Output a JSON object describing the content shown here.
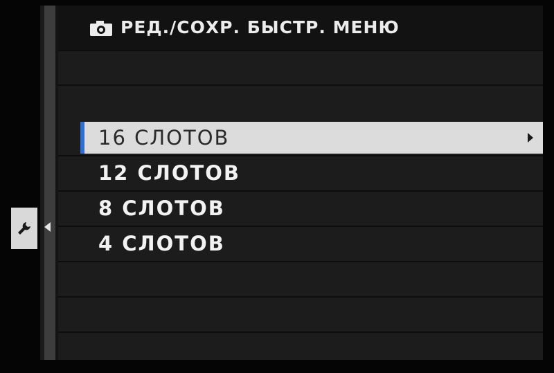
{
  "header": {
    "icon": "camera-icon",
    "title": "РЕД./СОХР. БЫСТР. МЕНЮ"
  },
  "sidebar": {
    "active_tab_icon": "wrench-icon",
    "arrow_icon": "triangle-left-icon"
  },
  "menu": {
    "items": [
      {
        "label": "16 СЛОТОВ",
        "selected": true
      },
      {
        "label": "12 СЛОТОВ",
        "selected": false
      },
      {
        "label": "8 СЛОТОВ",
        "selected": false
      },
      {
        "label": "4 СЛОТОВ",
        "selected": false
      }
    ],
    "submenu_icon": "triangle-right-icon"
  },
  "colors": {
    "accent": "#2f6fd0",
    "selection_bg": "#dcdcdc",
    "panel_bg": "#1c1c1c"
  }
}
